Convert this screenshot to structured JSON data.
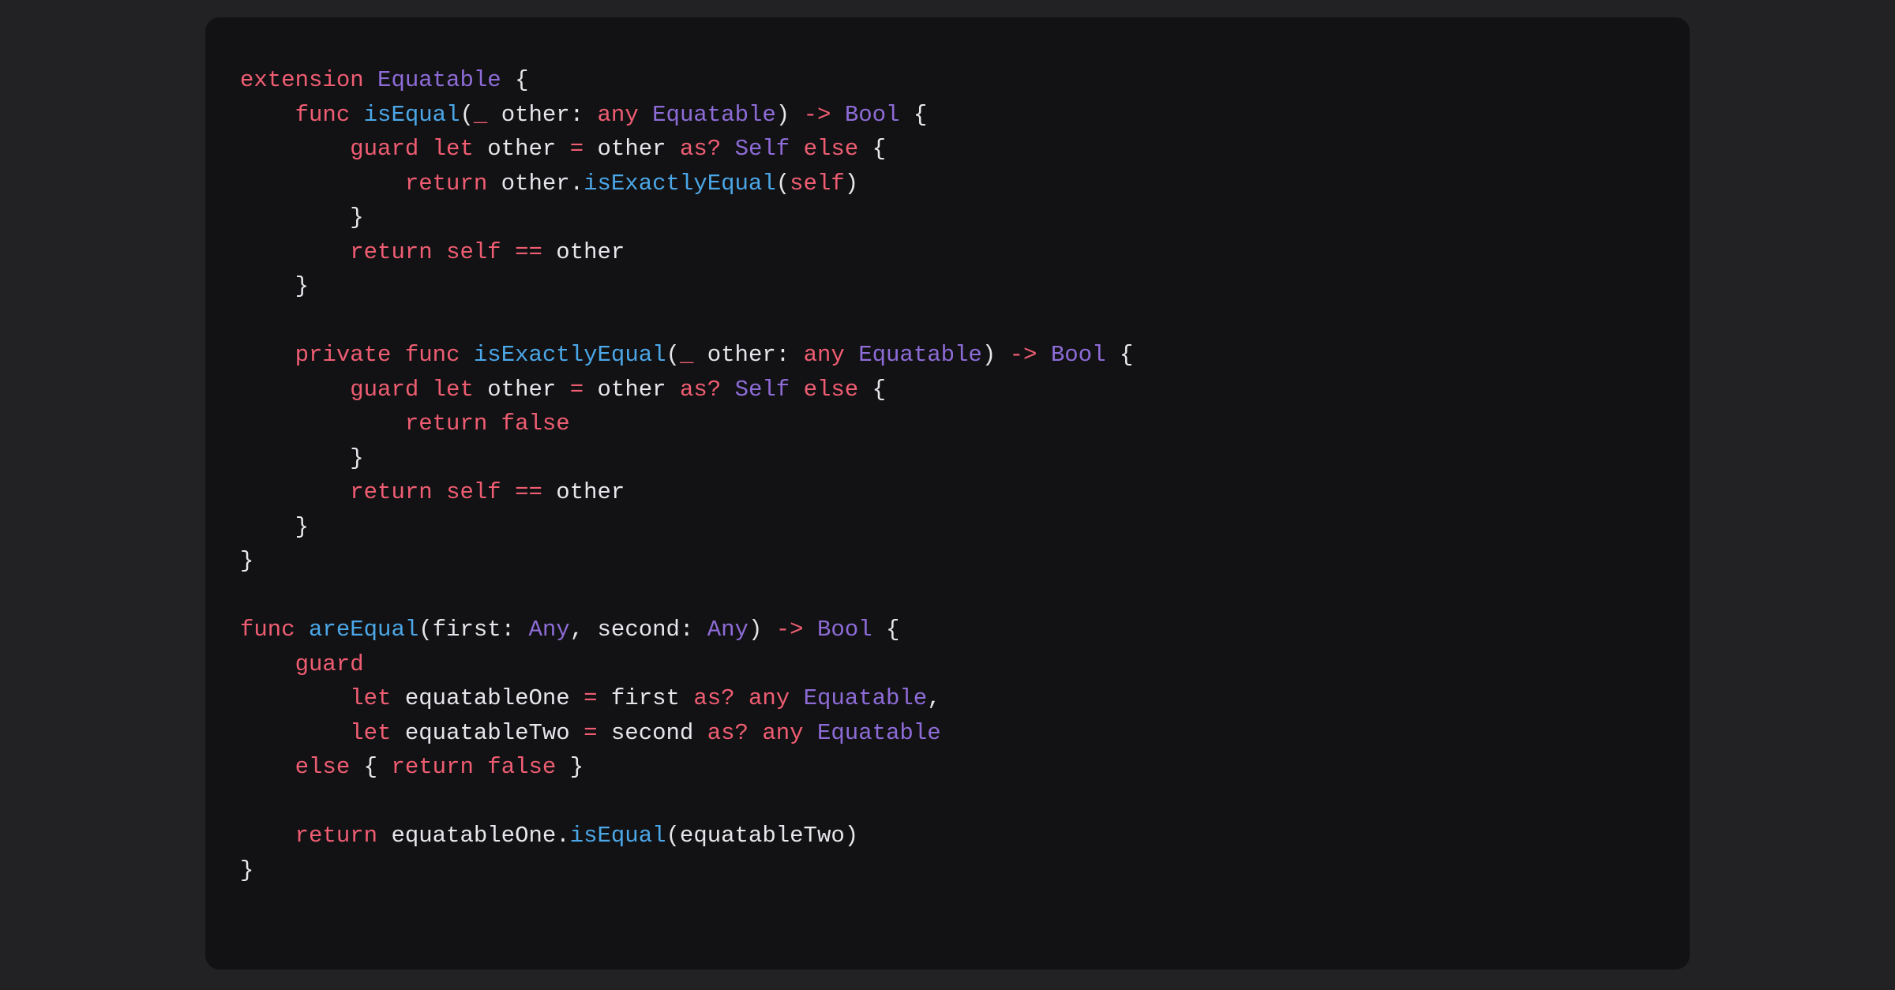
{
  "code": {
    "language": "swift",
    "tokens": [
      [
        [
          "kw",
          "extension"
        ],
        [
          "plain",
          " "
        ],
        [
          "type",
          "Equatable"
        ],
        [
          "plain",
          " {"
        ]
      ],
      [
        [
          "plain",
          "    "
        ],
        [
          "kw",
          "func"
        ],
        [
          "plain",
          " "
        ],
        [
          "fn",
          "isEqual"
        ],
        [
          "plain",
          "("
        ],
        [
          "kw",
          "_"
        ],
        [
          "plain",
          " other: "
        ],
        [
          "kw",
          "any"
        ],
        [
          "plain",
          " "
        ],
        [
          "type",
          "Equatable"
        ],
        [
          "plain",
          ") "
        ],
        [
          "eq",
          "->"
        ],
        [
          "plain",
          " "
        ],
        [
          "type",
          "Bool"
        ],
        [
          "plain",
          " {"
        ]
      ],
      [
        [
          "plain",
          "        "
        ],
        [
          "kw",
          "guard"
        ],
        [
          "plain",
          " "
        ],
        [
          "kw",
          "let"
        ],
        [
          "plain",
          " other "
        ],
        [
          "eq",
          "="
        ],
        [
          "plain",
          " other "
        ],
        [
          "kw",
          "as?"
        ],
        [
          "plain",
          " "
        ],
        [
          "type",
          "Self"
        ],
        [
          "plain",
          " "
        ],
        [
          "kw",
          "else"
        ],
        [
          "plain",
          " {"
        ]
      ],
      [
        [
          "plain",
          "            "
        ],
        [
          "kw",
          "return"
        ],
        [
          "plain",
          " other."
        ],
        [
          "fn",
          "isExactlyEqual"
        ],
        [
          "plain",
          "("
        ],
        [
          "self",
          "self"
        ],
        [
          "plain",
          ")"
        ]
      ],
      [
        [
          "plain",
          "        }"
        ]
      ],
      [
        [
          "plain",
          "        "
        ],
        [
          "kw",
          "return"
        ],
        [
          "plain",
          " "
        ],
        [
          "self",
          "self"
        ],
        [
          "plain",
          " "
        ],
        [
          "eq",
          "=="
        ],
        [
          "plain",
          " other"
        ]
      ],
      [
        [
          "plain",
          "    }"
        ]
      ],
      [],
      [
        [
          "plain",
          "    "
        ],
        [
          "kw",
          "private"
        ],
        [
          "plain",
          " "
        ],
        [
          "kw",
          "func"
        ],
        [
          "plain",
          " "
        ],
        [
          "fn",
          "isExactlyEqual"
        ],
        [
          "plain",
          "("
        ],
        [
          "kw",
          "_"
        ],
        [
          "plain",
          " other: "
        ],
        [
          "kw",
          "any"
        ],
        [
          "plain",
          " "
        ],
        [
          "type",
          "Equatable"
        ],
        [
          "plain",
          ") "
        ],
        [
          "eq",
          "->"
        ],
        [
          "plain",
          " "
        ],
        [
          "type",
          "Bool"
        ],
        [
          "plain",
          " {"
        ]
      ],
      [
        [
          "plain",
          "        "
        ],
        [
          "kw",
          "guard"
        ],
        [
          "plain",
          " "
        ],
        [
          "kw",
          "let"
        ],
        [
          "plain",
          " other "
        ],
        [
          "eq",
          "="
        ],
        [
          "plain",
          " other "
        ],
        [
          "kw",
          "as?"
        ],
        [
          "plain",
          " "
        ],
        [
          "type",
          "Self"
        ],
        [
          "plain",
          " "
        ],
        [
          "kw",
          "else"
        ],
        [
          "plain",
          " {"
        ]
      ],
      [
        [
          "plain",
          "            "
        ],
        [
          "kw",
          "return"
        ],
        [
          "plain",
          " "
        ],
        [
          "lit",
          "false"
        ]
      ],
      [
        [
          "plain",
          "        }"
        ]
      ],
      [
        [
          "plain",
          "        "
        ],
        [
          "kw",
          "return"
        ],
        [
          "plain",
          " "
        ],
        [
          "self",
          "self"
        ],
        [
          "plain",
          " "
        ],
        [
          "eq",
          "=="
        ],
        [
          "plain",
          " other"
        ]
      ],
      [
        [
          "plain",
          "    }"
        ]
      ],
      [
        [
          "plain",
          "}"
        ]
      ],
      [],
      [
        [
          "kw",
          "func"
        ],
        [
          "plain",
          " "
        ],
        [
          "fn",
          "areEqual"
        ],
        [
          "plain",
          "(first: "
        ],
        [
          "type",
          "Any"
        ],
        [
          "plain",
          ", second: "
        ],
        [
          "type",
          "Any"
        ],
        [
          "plain",
          ") "
        ],
        [
          "eq",
          "->"
        ],
        [
          "plain",
          " "
        ],
        [
          "type",
          "Bool"
        ],
        [
          "plain",
          " {"
        ]
      ],
      [
        [
          "plain",
          "    "
        ],
        [
          "kw",
          "guard"
        ]
      ],
      [
        [
          "plain",
          "        "
        ],
        [
          "kw",
          "let"
        ],
        [
          "plain",
          " equatableOne "
        ],
        [
          "eq",
          "="
        ],
        [
          "plain",
          " first "
        ],
        [
          "kw",
          "as?"
        ],
        [
          "plain",
          " "
        ],
        [
          "kw",
          "any"
        ],
        [
          "plain",
          " "
        ],
        [
          "type",
          "Equatable"
        ],
        [
          "plain",
          ","
        ]
      ],
      [
        [
          "plain",
          "        "
        ],
        [
          "kw",
          "let"
        ],
        [
          "plain",
          " equatableTwo "
        ],
        [
          "eq",
          "="
        ],
        [
          "plain",
          " second "
        ],
        [
          "kw",
          "as?"
        ],
        [
          "plain",
          " "
        ],
        [
          "kw",
          "any"
        ],
        [
          "plain",
          " "
        ],
        [
          "type",
          "Equatable"
        ]
      ],
      [
        [
          "plain",
          "    "
        ],
        [
          "kw",
          "else"
        ],
        [
          "plain",
          " { "
        ],
        [
          "kw",
          "return"
        ],
        [
          "plain",
          " "
        ],
        [
          "lit",
          "false"
        ],
        [
          "plain",
          " }"
        ]
      ],
      [],
      [
        [
          "plain",
          "    "
        ],
        [
          "kw",
          "return"
        ],
        [
          "plain",
          " equatableOne."
        ],
        [
          "fn",
          "isEqual"
        ],
        [
          "plain",
          "(equatableTwo)"
        ]
      ],
      [
        [
          "plain",
          "}"
        ]
      ]
    ]
  }
}
